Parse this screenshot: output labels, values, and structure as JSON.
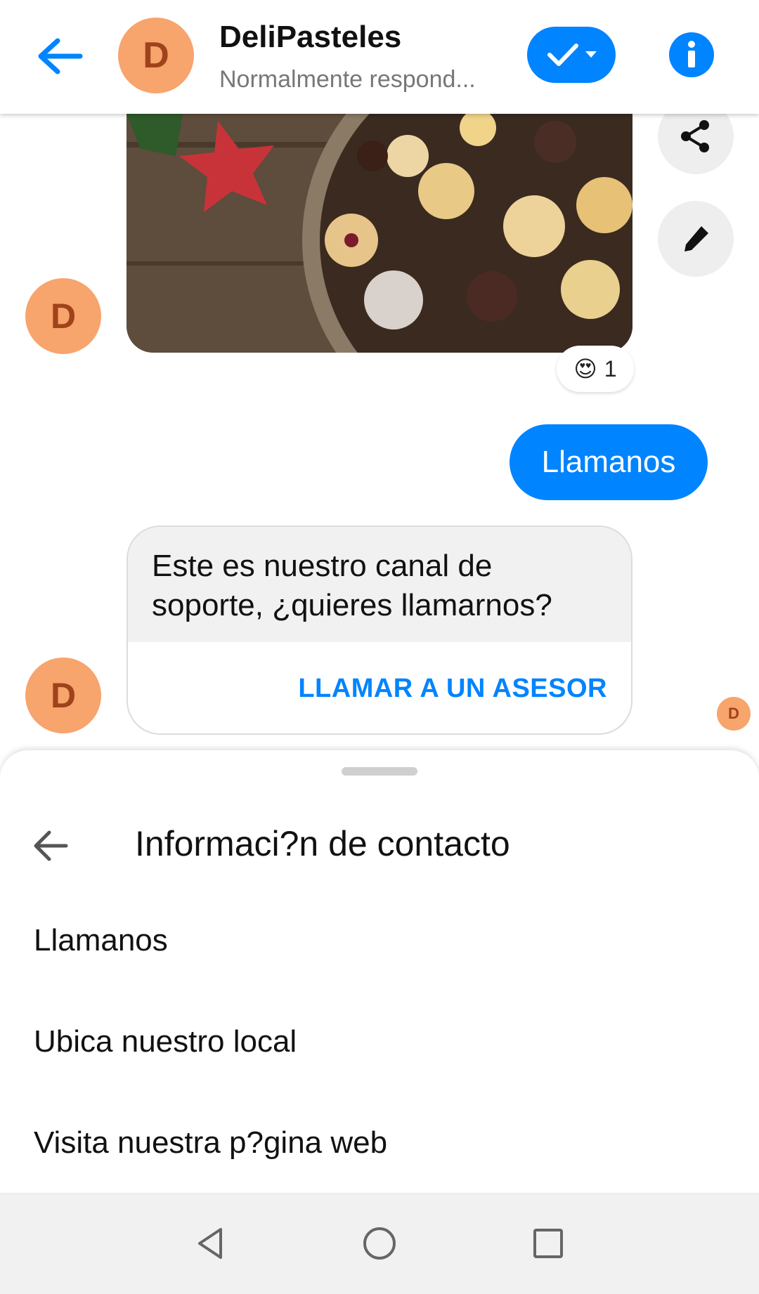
{
  "header": {
    "avatar_letter": "D",
    "title": "DeliPasteles",
    "subtitle": "Normalmente respond..."
  },
  "chat": {
    "reaction_emoji": "😍",
    "reaction_count": "1",
    "outgoing_message": "Llamanos",
    "card_text": "Este es nuestro canal de soporte, ¿quieres llamarnos?",
    "card_button": "LLAMAR A UN ASESOR",
    "avatar_letter": "D"
  },
  "sheet": {
    "title": "Informaci?n de contacto",
    "items": [
      {
        "label": "Llamanos"
      },
      {
        "label": "Ubica nuestro local"
      },
      {
        "label": "Visita nuestra p?gina web"
      }
    ]
  },
  "icons": {
    "back": "arrow-left-icon",
    "check": "check-icon",
    "info": "info-icon",
    "share": "share-icon",
    "edit": "pencil-icon",
    "nav_back": "triangle-back-icon",
    "nav_home": "circle-home-icon",
    "nav_recent": "square-recent-icon"
  },
  "colors": {
    "accent": "#0084ff",
    "avatar_bg": "#f7a46d",
    "avatar_fg": "#a0421a"
  }
}
